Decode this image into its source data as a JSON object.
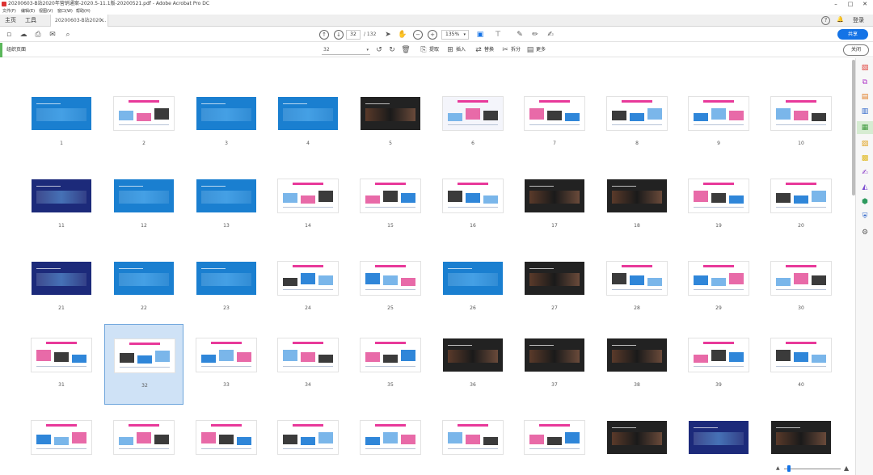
{
  "window": {
    "title": "20200603-B站2020年营销通案-2020.5-11.1版-20200521.pdf - Adobe Acrobat Pro DC",
    "controls": [
      "–",
      "□",
      "✕"
    ]
  },
  "menu": [
    "文件(F)",
    "编辑(E)",
    "视图(V)",
    "窗口(W)",
    "帮助(H)"
  ],
  "tabs": {
    "home": "主页",
    "tools": "工具",
    "doc": "20200603-B站2020...",
    "close": "×"
  },
  "header_right": {
    "help": "?",
    "bell": "🔔",
    "login": "登录"
  },
  "toolbar": {
    "page_current": "32",
    "page_total": "/ 132",
    "zoom": "135%",
    "share": "共享"
  },
  "organize": {
    "title": "组织页面",
    "size_value": "32",
    "extract": "提取",
    "insert": "插入",
    "replace": "替换",
    "split": "拆分",
    "more": "更多",
    "close": "关闭"
  },
  "pages": [
    {
      "label": "1",
      "style": "b"
    },
    {
      "label": "2",
      "style": "w"
    },
    {
      "label": "3",
      "style": "b"
    },
    {
      "label": "4",
      "style": "b"
    },
    {
      "label": "5",
      "style": "d"
    },
    {
      "label": "6",
      "style": "p"
    },
    {
      "label": "7",
      "style": "w"
    },
    {
      "label": "8",
      "style": "w"
    },
    {
      "label": "9",
      "style": "w"
    },
    {
      "label": "10",
      "style": "w"
    },
    {
      "label": "11",
      "style": "n"
    },
    {
      "label": "12",
      "style": "b"
    },
    {
      "label": "13",
      "style": "b"
    },
    {
      "label": "14",
      "style": "w"
    },
    {
      "label": "15",
      "style": "w"
    },
    {
      "label": "16",
      "style": "w"
    },
    {
      "label": "17",
      "style": "d"
    },
    {
      "label": "18",
      "style": "d"
    },
    {
      "label": "19",
      "style": "w"
    },
    {
      "label": "20",
      "style": "w"
    },
    {
      "label": "21",
      "style": "n"
    },
    {
      "label": "22",
      "style": "b"
    },
    {
      "label": "23",
      "style": "b"
    },
    {
      "label": "24",
      "style": "w"
    },
    {
      "label": "25",
      "style": "w"
    },
    {
      "label": "26",
      "style": "b"
    },
    {
      "label": "27",
      "style": "d"
    },
    {
      "label": "28",
      "style": "w"
    },
    {
      "label": "29",
      "style": "w"
    },
    {
      "label": "30",
      "style": "w"
    },
    {
      "label": "31",
      "style": "w"
    },
    {
      "label": "32",
      "style": "w"
    },
    {
      "label": "33",
      "style": "w"
    },
    {
      "label": "34",
      "style": "w"
    },
    {
      "label": "35",
      "style": "w"
    },
    {
      "label": "36",
      "style": "d"
    },
    {
      "label": "37",
      "style": "d"
    },
    {
      "label": "38",
      "style": "d"
    },
    {
      "label": "39",
      "style": "w"
    },
    {
      "label": "40",
      "style": "w"
    },
    {
      "label": "",
      "style": "w"
    },
    {
      "label": "",
      "style": "w"
    },
    {
      "label": "",
      "style": "w"
    },
    {
      "label": "",
      "style": "w"
    },
    {
      "label": "",
      "style": "w"
    },
    {
      "label": "",
      "style": "w"
    },
    {
      "label": "",
      "style": "w"
    },
    {
      "label": "",
      "style": "d"
    },
    {
      "label": "",
      "style": "n"
    },
    {
      "label": "",
      "style": "d"
    }
  ],
  "selected_page": "32",
  "colors": {
    "accent": "#1473e6",
    "selection": "#cfe2f6",
    "organize_green": "#5bb75b",
    "slide_pink": "#e8399a"
  }
}
